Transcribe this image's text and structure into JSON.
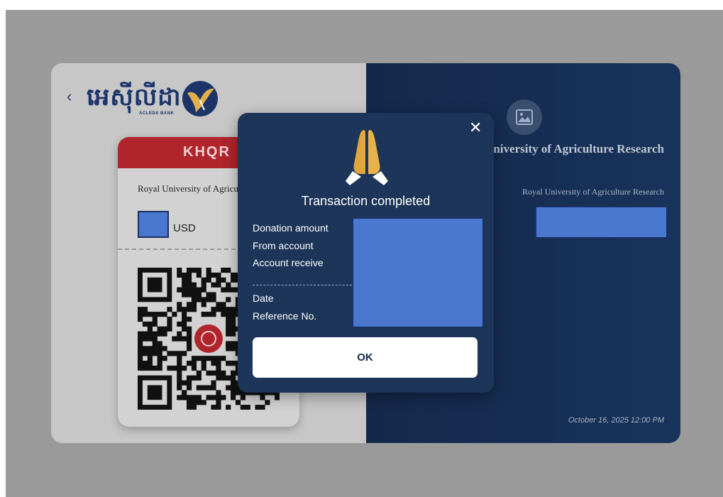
{
  "header": {
    "back_icon": "chevron-left-icon",
    "brand_text": "អេស៊ីលីដា",
    "brand_sub": "ACLEDA BANK",
    "logo_icon": "acleda-bird-logo"
  },
  "khqr_card": {
    "label": "KHQR",
    "merchant_name": "Royal University of Agriculture Research",
    "currency": "USD",
    "center_icon": "khqr-badge-icon"
  },
  "receipt_panel": {
    "image_icon": "image-placeholder-icon",
    "title": "Royal University of Agriculture Research",
    "subtitle": "Royal University of Agriculture Research",
    "datetime": "October 16, 2025 12:00 PM"
  },
  "modal": {
    "icon": "praying-hands-icon",
    "close_icon": "close-icon",
    "title": "Transaction completed",
    "labels": {
      "donation_amount": "Donation amount",
      "from_account": "From account",
      "account_receive": "Account receive",
      "date": "Date",
      "reference_no": "Reference No."
    },
    "ok_label": "OK"
  },
  "colors": {
    "navy": "#1d3558",
    "khqr_red": "#b0242c",
    "redaction_blue": "#4a78cf",
    "prayer_gold": "#e2a73a"
  }
}
